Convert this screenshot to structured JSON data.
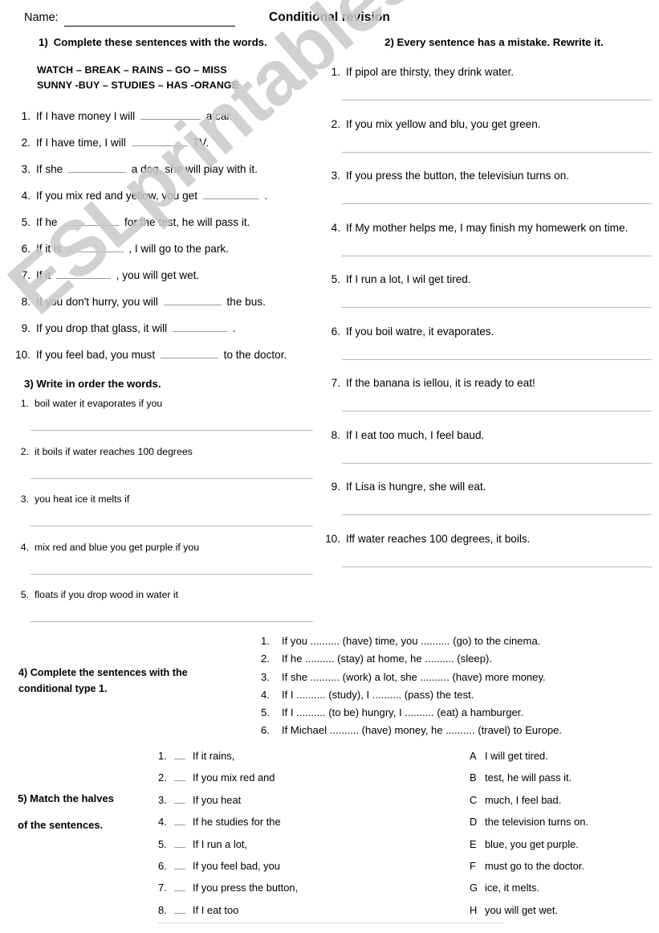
{
  "header": {
    "name_label": "Name:",
    "title": "Conditional revision"
  },
  "exercise1": {
    "number": "1)",
    "heading": "Complete these sentences with the words.",
    "wordbank_line1": "WATCH – BREAK – RAINS – GO – MISS",
    "wordbank_line2": "SUNNY -BUY – STUDIES – HAS -ORANGE",
    "items": [
      {
        "n": "1.",
        "before": "If I have money I will",
        "blank": 75,
        "after": "a car."
      },
      {
        "n": "2.",
        "before": "If I have time, I will",
        "blank": 70,
        "after": "TV."
      },
      {
        "n": "3.",
        "before": "If she",
        "blank": 72,
        "after": "a dog, she will play with it."
      },
      {
        "n": "4.",
        "before": "If you mix red and yellow, you get",
        "blank": 70,
        "after": "."
      },
      {
        "n": "5.",
        "before": "If he",
        "blank": 70,
        "after": "for the test, he will pass it."
      },
      {
        "n": "6.",
        "before": "If it is",
        "blank": 70,
        "after": ", I will go to the park."
      },
      {
        "n": "7.",
        "before": "If it",
        "blank": 68,
        "after": ", you will get wet."
      },
      {
        "n": "8.",
        "before": "If you don't hurry, you will",
        "blank": 72,
        "after": "the bus."
      },
      {
        "n": "9.",
        "before": "If you drop that glass, it will",
        "blank": 68,
        "after": "."
      },
      {
        "n": "10.",
        "before": "If you feel bad, you must",
        "blank": 72,
        "after": "to the doctor."
      }
    ]
  },
  "exercise2": {
    "number": "2)",
    "heading": "Every sentence has a mistake. Rewrite it.",
    "items": [
      {
        "n": "1.",
        "text": "If pipol are thirsty, they drink water."
      },
      {
        "n": "2.",
        "text": "If you mix yellow and blu, you get green."
      },
      {
        "n": "3.",
        "text": "If you press the button, the televisiun turns on."
      },
      {
        "n": "4.",
        "text": "If My mother helps me, I may finish my homewerk on time."
      },
      {
        "n": "5.",
        "text": "If I run a lot, I wil get tired."
      },
      {
        "n": "6.",
        "text": "If you boil watre, it evaporates."
      },
      {
        "n": "7.",
        "text": "If the banana is iellou, it is ready to eat!"
      },
      {
        "n": "8.",
        "text": "If I eat too much, I feel baud."
      },
      {
        "n": "9.",
        "text": "If Lisa is hungre, she will eat."
      },
      {
        "n": "10.",
        "text": "Iff water reaches 100 degrees, it boils."
      }
    ]
  },
  "exercise3": {
    "heading": "3) Write in order the words.",
    "items": [
      {
        "n": "1.",
        "text": "boil water it evaporates if you"
      },
      {
        "n": "2.",
        "text": "it boils if water reaches 100 degrees"
      },
      {
        "n": "3.",
        "text": "you heat ice it melts if"
      },
      {
        "n": "4.",
        "text": "mix red and blue you get purple if you"
      },
      {
        "n": "5.",
        "text": "floats if you drop wood in water it"
      }
    ]
  },
  "exercise4": {
    "heading_line1": "4) Complete the sentences with the",
    "heading_line2": "conditional type 1.",
    "items": [
      {
        "n": "1.",
        "text": "If you .......... (have) time, you .......... (go) to the cinema."
      },
      {
        "n": "2.",
        "text": "If he .......... (stay) at home, he .......... (sleep)."
      },
      {
        "n": "3.",
        "text": "If she .......... (work) a lot, she .......... (have) more money."
      },
      {
        "n": "4.",
        "text": "If I .......... (study), I .......... (pass) the test."
      },
      {
        "n": "5.",
        "text": "If I .......... (to be) hungry, I .......... (eat) a hamburger."
      },
      {
        "n": "6.",
        "text": "If Michael .......... (have) money, he .......... (travel) to Europe."
      }
    ]
  },
  "exercise5": {
    "heading_line1": "5) Match the halves",
    "heading_line2": "of the sentences.",
    "left": [
      {
        "n": "1.",
        "text": "If it rains,"
      },
      {
        "n": "2.",
        "text": "If you mix red and"
      },
      {
        "n": "3.",
        "text": "If you heat"
      },
      {
        "n": "4.",
        "text": "If he studies for the"
      },
      {
        "n": "5.",
        "text": "If I run a lot,"
      },
      {
        "n": "6.",
        "text": "If you feel bad, you"
      },
      {
        "n": "7.",
        "text": "If you press the button,"
      },
      {
        "n": "8.",
        "text": "If I eat too"
      }
    ],
    "right": [
      {
        "l": "A",
        "text": "I will get tired."
      },
      {
        "l": "B",
        "text": "test, he will pass it."
      },
      {
        "l": "C",
        "text": "much, I feel bad."
      },
      {
        "l": "D",
        "text": "the television turns on."
      },
      {
        "l": "E",
        "text": "blue, you get purple."
      },
      {
        "l": "F",
        "text": "must go to the doctor."
      },
      {
        "l": "G",
        "text": "ice, it melts."
      },
      {
        "l": "H",
        "text": "you will get wet."
      }
    ]
  },
  "watermark": {
    "text": "ESLprintables.com"
  }
}
